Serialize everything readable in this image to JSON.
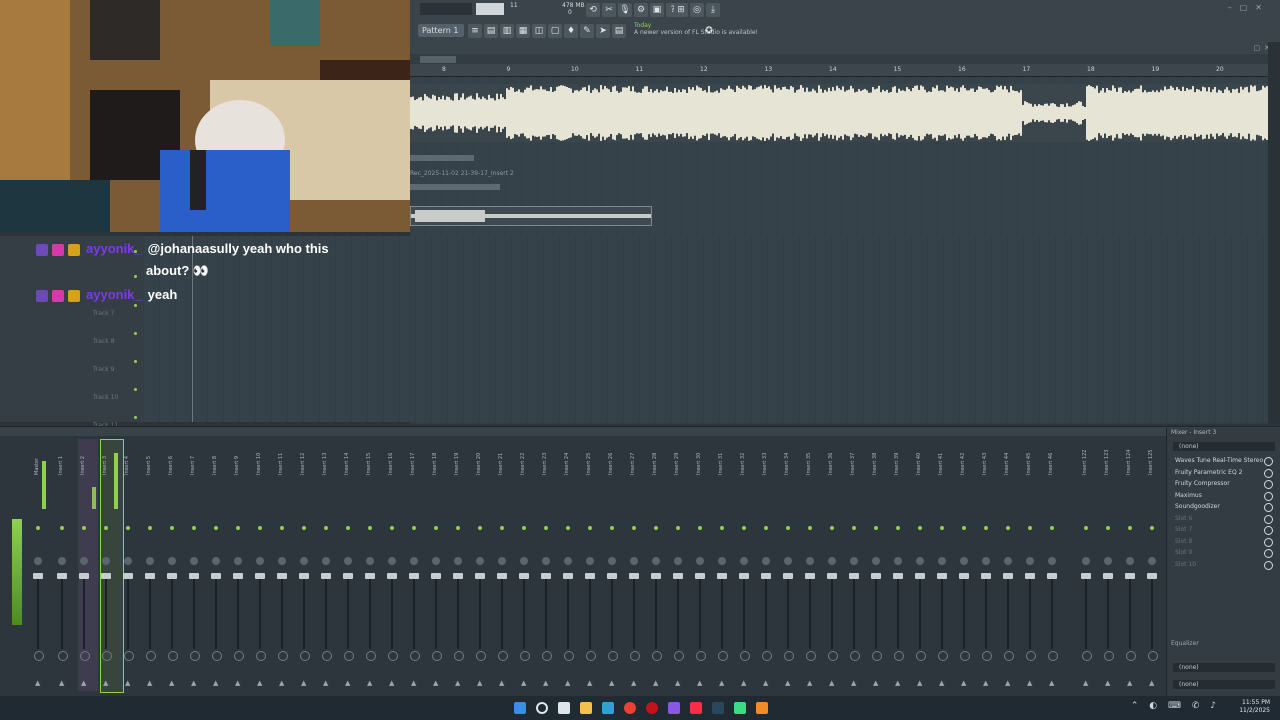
{
  "toolbar": {
    "cpu": "11",
    "memory": "478 MB",
    "voices": "0",
    "pattern": "Pattern 1",
    "notice_day": "Today",
    "notice_text": "A newer version of FL Studio is available!"
  },
  "timeline": {
    "bars": [
      "8",
      "9",
      "10",
      "11",
      "12",
      "13",
      "14",
      "15",
      "16",
      "17",
      "18",
      "19",
      "20"
    ]
  },
  "playlist": {
    "clip_label": "Rec_2025-11-02 21-39-17_Insert 2",
    "tracks": [
      "Track 7",
      "Track 8",
      "Track 9",
      "Track 10",
      "Track 11"
    ]
  },
  "chat": [
    {
      "user": "ayyonik_",
      "text": "@johanaasully yeah who this",
      "text2": "about? 👀"
    },
    {
      "user": "ayyonik_",
      "text": "yeah"
    }
  ],
  "mixer": {
    "title": "Mixer - Insert 3",
    "channels": [
      "Master",
      "Insert 1",
      "Insert 2",
      "Insert 3",
      "Insert 4",
      "Insert 5",
      "Insert 6",
      "Insert 7",
      "Insert 8",
      "Insert 9",
      "Insert 10",
      "Insert 11",
      "Insert 12",
      "Insert 13",
      "Insert 14",
      "Insert 15",
      "Insert 16",
      "Insert 17",
      "Insert 18",
      "Insert 19",
      "Insert 20",
      "Insert 21",
      "Insert 22",
      "Insert 23",
      "Insert 24",
      "Insert 25",
      "Insert 26",
      "Insert 27",
      "Insert 28",
      "Insert 29",
      "Insert 30",
      "Insert 31",
      "Insert 32",
      "Insert 33",
      "Insert 34",
      "Insert 35",
      "Insert 36",
      "Insert 37",
      "Insert 38",
      "Insert 39",
      "Insert 40",
      "Insert 41",
      "Insert 42",
      "Insert 43",
      "Insert 44",
      "Insert 45",
      "Insert 46"
    ],
    "extra_channels": [
      "Insert 122",
      "Insert 123",
      "Insert 124",
      "Insert 125"
    ]
  },
  "fx": {
    "input": "(none)",
    "slots": [
      "Waves Tune Real-Time Stereo",
      "Fruity Parametric EQ 2",
      "Fruity Compressor",
      "Maximus",
      "Soundgoodizer",
      "Slot 6",
      "Slot 7",
      "Slot 8",
      "Slot 9",
      "Slot 10"
    ],
    "equalizer_label": "Equalizer",
    "out1": "(none)",
    "out2": "(none)"
  },
  "taskbar": {
    "time": "11:55 PM",
    "date": "11/2/2025"
  },
  "colors": {
    "accent": "#8fd14f",
    "background": "#2c3439",
    "chat_user": "#7c3aed"
  }
}
